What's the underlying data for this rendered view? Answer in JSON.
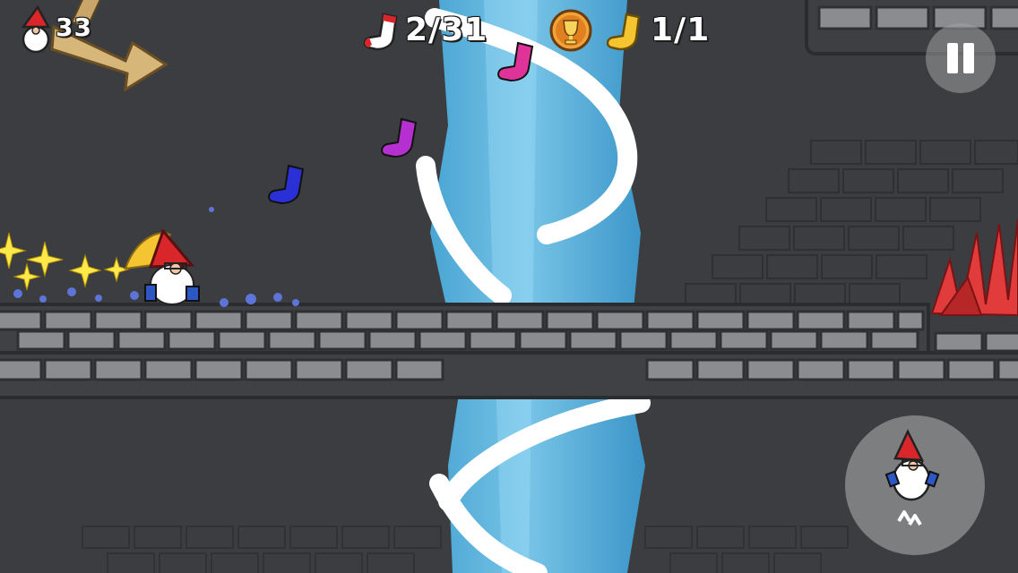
{
  "hud": {
    "lives": "33",
    "socks_collected": "2/31",
    "golden_socks": "1/1"
  },
  "controls": {
    "pause": "pause",
    "jump": "jump"
  },
  "colors": {
    "background": "#3b3d40",
    "brick_fill": "#8a8c90",
    "brick_line": "#2e3033",
    "tornado": "#6cc5ef",
    "sock_blue": "#2b2fd6",
    "sock_purple": "#b52fd1",
    "sock_pink": "#e0339a",
    "sock_gold": "#f5c531",
    "gnome_hat": "#d9262b",
    "spikes": "#e23b3b"
  },
  "icons": [
    "gnome-head-icon",
    "arrow-sign-icon",
    "sock-icon",
    "trophy-icon",
    "golden-sock-icon",
    "pause-icon",
    "gnome-jump-icon"
  ]
}
